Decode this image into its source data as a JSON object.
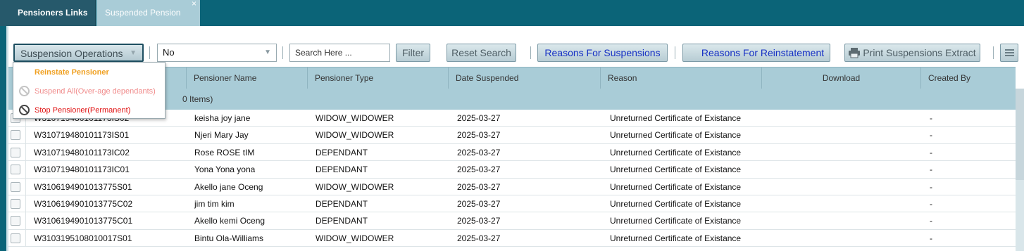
{
  "tabs": [
    {
      "label": "Pensioners Links"
    },
    {
      "label": "Suspended Pension",
      "close": "×"
    }
  ],
  "toolbar": {
    "operations_label": "Suspension Operations",
    "filter_select_value": "No",
    "search_placeholder": "Search Here ...",
    "filter_label": "Filter",
    "reset_label": "Reset Search",
    "reasons_suspensions_label": "Reasons For Suspensions",
    "reasons_reinstatement_label": "Reasons For Reinstatement",
    "print_label": "Print Suspensions Extract"
  },
  "dropdown": {
    "items": [
      {
        "label": "Reinstate Pensioner",
        "color": "#f0a020"
      },
      {
        "label": "Suspend All(Over-age dependants)",
        "color": "#f08c8c"
      },
      {
        "label": "Stop Pensioner(Permanent)",
        "color": "#e01010"
      }
    ]
  },
  "grid": {
    "columns": [
      "Pensioner Name",
      "Pensioner Type",
      "Date Suspended",
      "Reason",
      "Download",
      "Created By"
    ],
    "group_label": "0 Items)",
    "rows": [
      {
        "id": "W310719480101173IS02",
        "name": "keisha joy jane",
        "type": "WIDOW_WIDOWER",
        "date": "2025-03-27",
        "reason": "Unreturned Certificate of Existance",
        "download": "",
        "created_by": "-"
      },
      {
        "id": "W310719480101173IS01",
        "name": "Njeri Mary Jay",
        "type": "WIDOW_WIDOWER",
        "date": "2025-03-27",
        "reason": "Unreturned Certificate of Existance",
        "download": "",
        "created_by": "-"
      },
      {
        "id": "W310719480101173IC02",
        "name": "Rose ROSE tIM",
        "type": "DEPENDANT",
        "date": "2025-03-27",
        "reason": "Unreturned Certificate of Existance",
        "download": "",
        "created_by": "-"
      },
      {
        "id": "W310719480101173IC01",
        "name": "Yona Yona yona",
        "type": "DEPENDANT",
        "date": "2025-03-27",
        "reason": "Unreturned Certificate of Existance",
        "download": "",
        "created_by": "-"
      },
      {
        "id": "W3106194901013775S01",
        "name": "Akello jane Oceng",
        "type": "WIDOW_WIDOWER",
        "date": "2025-03-27",
        "reason": "Unreturned Certificate of Existance",
        "download": "",
        "created_by": "-"
      },
      {
        "id": "W3106194901013775C02",
        "name": "jim tim kim",
        "type": "DEPENDANT",
        "date": "2025-03-27",
        "reason": "Unreturned Certificate of Existance",
        "download": "",
        "created_by": "-"
      },
      {
        "id": "W3106194901013775C01",
        "name": "Akello kemi Oceng",
        "type": "DEPENDANT",
        "date": "2025-03-27",
        "reason": "Unreturned Certificate of Existance",
        "download": "",
        "created_by": "-"
      },
      {
        "id": "W3103195108010017S01",
        "name": "Bintu Ola-Williams",
        "type": "WIDOW_WIDOWER",
        "date": "2025-03-27",
        "reason": "Unreturned Certificate of Existance",
        "download": "",
        "created_by": "-"
      }
    ]
  },
  "colors": {
    "brand": "#0b6478",
    "header": "#a9ccd7",
    "link_blue": "#1630c4"
  }
}
